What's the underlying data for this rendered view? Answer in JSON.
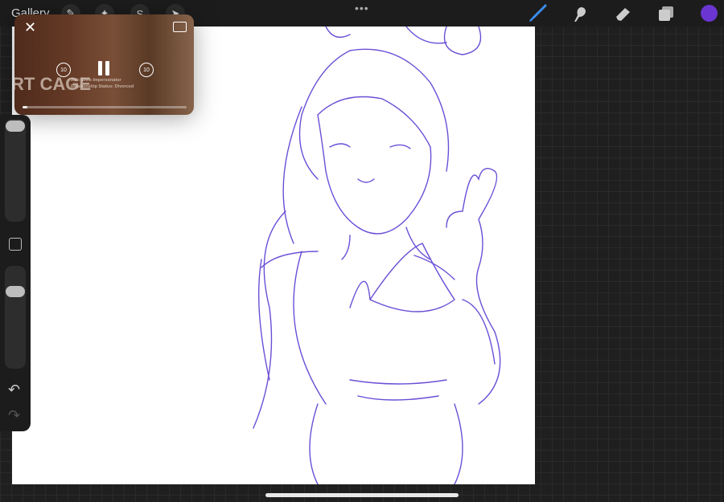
{
  "topbar": {
    "gallery_label": "Gallery",
    "more_icon": "•••",
    "left_tools": [
      "wrench-icon",
      "adjustments-icon",
      "selection-icon",
      "transform-icon"
    ],
    "right_tools": [
      "brush-icon",
      "smudge-icon",
      "eraser-icon",
      "layers-icon"
    ],
    "current_color": "#6a35d0"
  },
  "pip": {
    "title_text": "RT CAGE",
    "info_line1": "Job: Elvis Impersonator",
    "info_line2": "Relationship Status: Divorced",
    "skip_back": "10",
    "skip_forward": "10",
    "progress_percent": 3
  },
  "sidebar": {
    "brush_size_level": 0.05,
    "opacity_level": 0.1,
    "undo_icon": "↶",
    "redo_icon": "↷"
  }
}
